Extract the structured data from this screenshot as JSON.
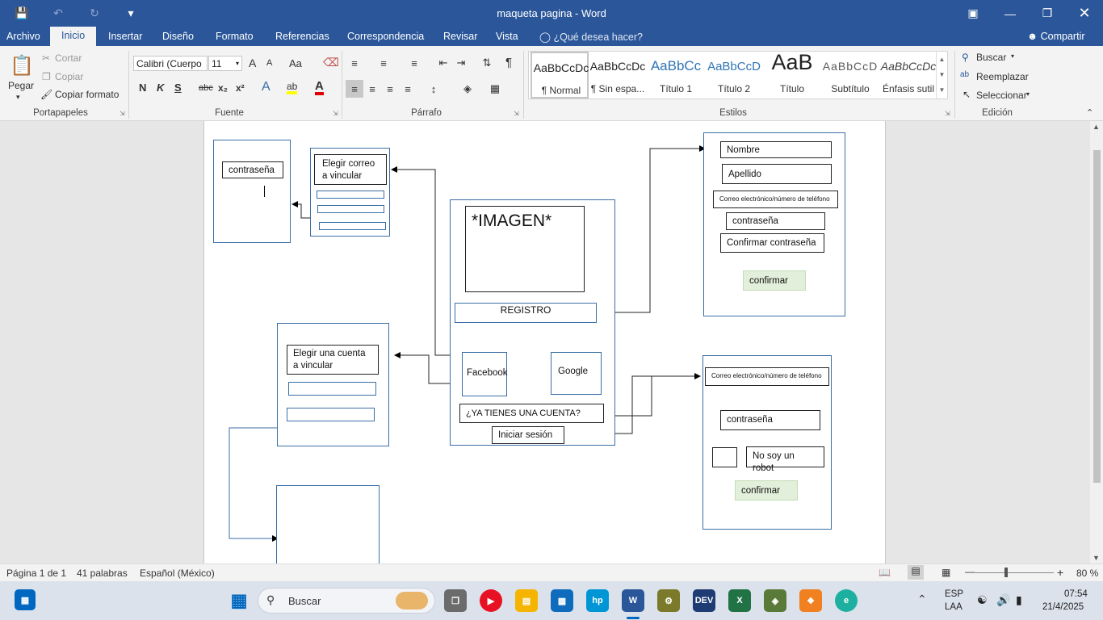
{
  "window": {
    "title": "maqueta pagina - Word",
    "file_tab": "Archivo",
    "share": "Compartir",
    "tell_me": "¿Qué desea hacer?"
  },
  "tabs": [
    "Inicio",
    "Insertar",
    "Diseño",
    "Formato",
    "Referencias",
    "Correspondencia",
    "Revisar",
    "Vista"
  ],
  "clipboard": {
    "paste": "Pegar",
    "cut": "Cortar",
    "copy": "Copiar",
    "format_painter": "Copiar formato",
    "group": "Portapapeles"
  },
  "font": {
    "name": "Calibri (Cuerpo",
    "size": "11",
    "case": "Aa",
    "bold": "N",
    "italic": "K",
    "underline": "S",
    "strike": "abc",
    "sub": "x₂",
    "sup": "x²",
    "grow": "A",
    "shrink": "A",
    "effects": "A",
    "highlight": "ab",
    "color": "A",
    "group": "Fuente"
  },
  "paragraph": {
    "group": "Párrafo",
    "pilcrow": "¶"
  },
  "styles": {
    "group": "Estilos",
    "items": [
      {
        "preview": "AaBbCcDc",
        "name": "¶ Normal"
      },
      {
        "preview": "AaBbCcDc",
        "name": "¶ Sin espa..."
      },
      {
        "preview": "AaBbCc",
        "name": "Título 1"
      },
      {
        "preview": "AaBbCcD",
        "name": "Título 2"
      },
      {
        "preview": "AaB",
        "name": "Título"
      },
      {
        "preview": "AaBbCcD",
        "name": "Subtítulo"
      },
      {
        "preview": "AaBbCcDc",
        "name": "Énfasis sutil"
      }
    ]
  },
  "editing": {
    "find": "Buscar",
    "replace": "Reemplazar",
    "select": "Seleccionar",
    "group": "Edición"
  },
  "mockup": {
    "left_password": "contraseña",
    "choose_email": "Elegir correo a vincular",
    "image": "*IMAGEN*",
    "register": "REGISTRO",
    "facebook": "Facebook",
    "google": "Google",
    "have_account": "¿YA TIENES UNA CUENTA?",
    "login": "Iniciar sesión",
    "choose_account": "Elegir una cuenta a vincular",
    "reg_name": "Nombre",
    "reg_lastname": "Apellido",
    "reg_email": "Correo electrónico/número de teléfono",
    "reg_password": "contraseña",
    "reg_confirm_password": "Confirmar contraseña",
    "reg_confirm": "confirmar",
    "login_email": "Correo electrónico/número de teléfono",
    "login_password": "contraseña",
    "login_robot": "No soy un robot",
    "login_confirm": "confirmar"
  },
  "status": {
    "page": "Página 1 de 1",
    "words": "41 palabras",
    "language": "Español (México)",
    "zoom": "80 %"
  },
  "taskbar": {
    "search": "Buscar",
    "lang_top": "ESP",
    "lang_bottom": "LAA",
    "time": "07:54",
    "date": "21/4/2025"
  },
  "colors": {
    "accent": "#2b579a",
    "box_border": "#3a6ea5",
    "confirm_green": "#e2efda"
  }
}
